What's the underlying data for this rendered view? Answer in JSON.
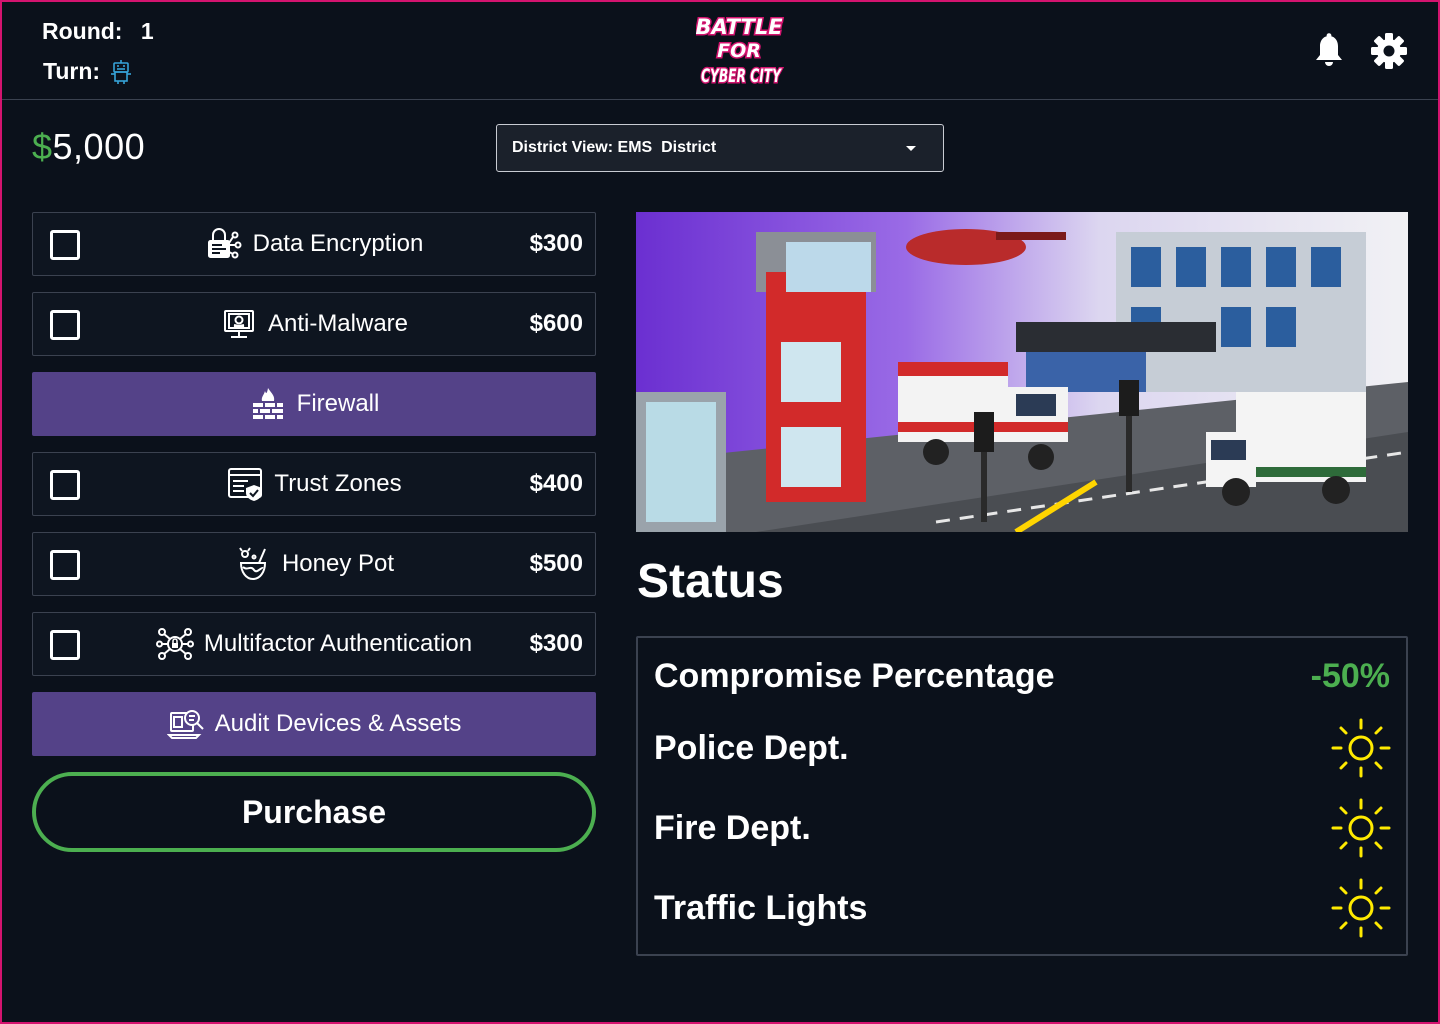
{
  "header": {
    "round_label": "Round:",
    "round_value": "1",
    "turn_label": "Turn:",
    "turn_icon": "hacker-bot-icon",
    "logo_lines": [
      "BATTLE",
      "FOR",
      "CYBER CITY"
    ],
    "notification_icon": "bell-icon",
    "settings_icon": "gear-icon"
  },
  "wallet": {
    "currency": "$",
    "amount": "5,000"
  },
  "district_select": {
    "value": "District View: EMS  District"
  },
  "defenses": [
    {
      "label": "Data Encryption",
      "price": "$300",
      "icon": "lock-network-icon",
      "selected": false
    },
    {
      "label": "Anti-Malware",
      "price": "$600",
      "icon": "monitor-skull-icon",
      "selected": false
    },
    {
      "label": "Firewall",
      "price": "",
      "icon": "firewall-icon",
      "selected": true
    },
    {
      "label": "Trust Zones",
      "price": "$400",
      "icon": "window-shield-icon",
      "selected": false
    },
    {
      "label": "Honey Pot",
      "price": "$500",
      "icon": "honey-pot-icon",
      "selected": false
    },
    {
      "label": "Multifactor Authentication",
      "price": "$300",
      "icon": "multifactor-icon",
      "selected": false
    },
    {
      "label": "Audit Devices & Assets",
      "price": "",
      "icon": "audit-search-icon",
      "selected": true
    }
  ],
  "purchase_label": "Purchase",
  "status": {
    "title": "Status",
    "compromise_label": "Compromise Percentage",
    "compromise_value": "-50%",
    "services": [
      {
        "label": "Police Dept.",
        "icon": "sun-icon"
      },
      {
        "label": "Fire Dept.",
        "icon": "sun-icon"
      },
      {
        "label": "Traffic Lights",
        "icon": "sun-icon"
      }
    ]
  },
  "colors": {
    "background": "#0b111b",
    "accent_purple": "#544288",
    "accent_green": "#4caf50",
    "frame_pink": "#d4146f",
    "sun_yellow": "#ffea00"
  }
}
